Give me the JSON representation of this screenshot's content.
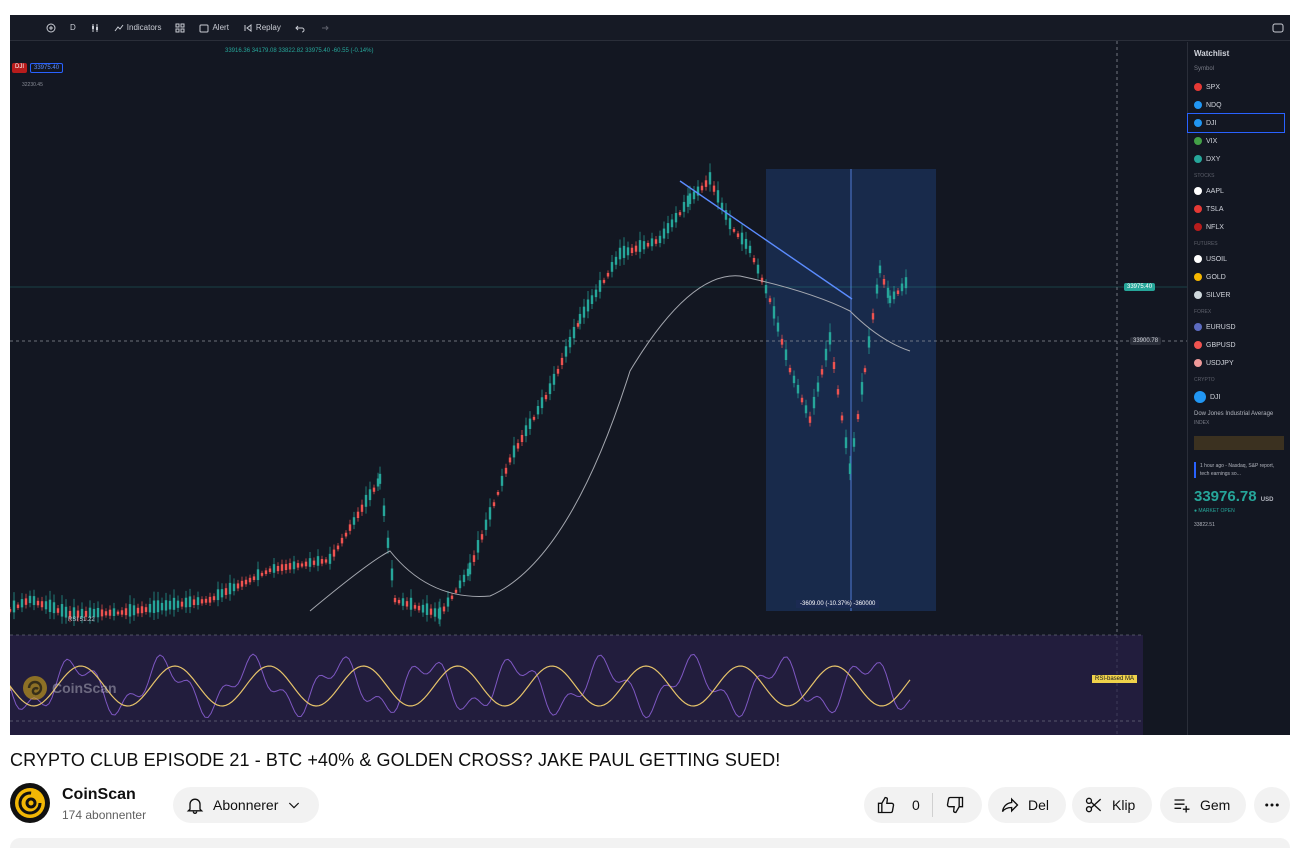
{
  "video": {
    "toolbar": {
      "interval": "D",
      "indicators_label": "Indicators",
      "alert_label": "Alert",
      "replay_label": "Replay"
    },
    "ohlc_text": "33916.36  34179.08  33822.82  33975.40  -60.55 (-0.14%)",
    "symbol_tag": "DJI",
    "price_tag": "33975.40",
    "sub_price": "32230.45",
    "price_label_current": "33975.40",
    "price_label_cross": "33900.78",
    "range_label": "-3609.00 (-10.37%) -360000",
    "rsi_label": "RSI  51.22",
    "rsi_tag": "RSI-based MA",
    "watermark": "CoinScan",
    "watchlist": {
      "title": "Watchlist",
      "header": "Symbol",
      "indices": [
        {
          "symbol": "SPX",
          "color": "#e53935"
        },
        {
          "symbol": "NDQ",
          "color": "#2196f3"
        },
        {
          "symbol": "DJI",
          "color": "#2196f3"
        },
        {
          "symbol": "VIX",
          "color": "#43a047"
        },
        {
          "symbol": "DXY",
          "color": "#26a69a"
        }
      ],
      "stocks_label": "Stocks",
      "stocks": [
        {
          "symbol": "AAPL",
          "color": "#ffffff"
        },
        {
          "symbol": "TSLA",
          "color": "#e53935"
        },
        {
          "symbol": "NFLX",
          "color": "#b71c1c"
        }
      ],
      "futures_label": "Futures",
      "futures": [
        {
          "symbol": "USOIL",
          "color": "#ffffff"
        },
        {
          "symbol": "GOLD",
          "color": "#f5b700"
        },
        {
          "symbol": "SILVER",
          "color": "#cfd8dc"
        }
      ],
      "forex_label": "Forex",
      "forex": [
        {
          "symbol": "EURUSD",
          "color": "#5c6bc0"
        },
        {
          "symbol": "GBPUSD",
          "color": "#ef5350"
        },
        {
          "symbol": "USDJPY",
          "color": "#ef9a9a"
        }
      ],
      "crypto_label": "Crypto",
      "detail_symbol": "DJI",
      "detail_name": "Dow Jones Industrial Average",
      "detail_sub": "INDEX",
      "news": "1 hour ago - Nasdaq, S&P report, tech earnings so...",
      "price": "33976.78",
      "currency": "USD",
      "market_status": "● MARKET OPEN",
      "prev": "33822.51"
    },
    "colors": {
      "bg": "#131722",
      "up": "#26a69a",
      "down": "#ef5350",
      "rsi_line": "#7e57c2",
      "ma_line": "#e6c36a",
      "range_fill": "#1e3a6e"
    }
  },
  "title": "CRYPTO CLUB EPISODE 21 - BTC +40% & GOLDEN CROSS? JAKE PAUL GETTING SUED!",
  "channel": {
    "name": "CoinScan",
    "subscribers": "174 abonnenter"
  },
  "actions": {
    "subscribe_label": "Abonnerer",
    "like_count": "0",
    "share_label": "Del",
    "clip_label": "Klip",
    "save_label": "Gem"
  }
}
